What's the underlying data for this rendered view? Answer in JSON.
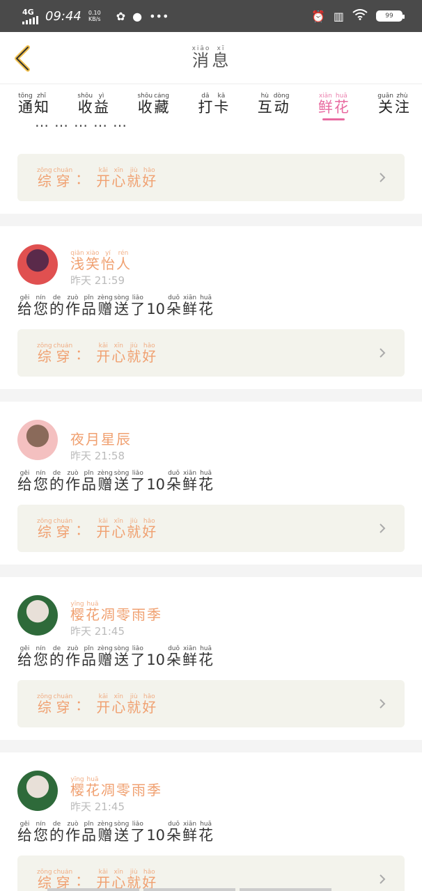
{
  "status_bar": {
    "network": "4G",
    "time": "09:44",
    "speed_top": "0.10",
    "speed_bottom": "KB/s",
    "battery": "99",
    "icons": [
      "wechat-icon",
      "qq-icon",
      "more-dots-icon",
      "alarm-icon",
      "vibrate-icon",
      "wifi-icon",
      "battery-icon"
    ]
  },
  "header": {
    "title": [
      {
        "py": "xiāo",
        "ch": "消"
      },
      {
        "py": "xī",
        "ch": "息"
      }
    ]
  },
  "tabs": [
    {
      "id": "notice",
      "chars": [
        {
          "py": "tōng",
          "ch": "通"
        },
        {
          "py": "zhī",
          "ch": "知"
        }
      ]
    },
    {
      "id": "income",
      "chars": [
        {
          "py": "shōu",
          "ch": "收"
        },
        {
          "py": "yì",
          "ch": "益"
        }
      ]
    },
    {
      "id": "favorite",
      "chars": [
        {
          "py": "shōu",
          "ch": "收"
        },
        {
          "py": "cáng",
          "ch": "藏"
        }
      ]
    },
    {
      "id": "checkin",
      "chars": [
        {
          "py": "dǎ",
          "ch": "打"
        },
        {
          "py": "kǎ",
          "ch": "卡"
        }
      ]
    },
    {
      "id": "interact",
      "chars": [
        {
          "py": "hù",
          "ch": "互"
        },
        {
          "py": "dòng",
          "ch": "动"
        }
      ]
    },
    {
      "id": "flowers",
      "active": true,
      "chars": [
        {
          "py": "xiān",
          "ch": "鲜"
        },
        {
          "py": "huā",
          "ch": "花"
        }
      ]
    },
    {
      "id": "follow",
      "chars": [
        {
          "py": "guān",
          "ch": "关"
        },
        {
          "py": "zhù",
          "ch": "注"
        }
      ]
    }
  ],
  "common": {
    "quote_label": [
      {
        "py": "zōng",
        "ch": "综"
      },
      {
        "py": "chuán",
        "ch": "穿"
      }
    ],
    "quote_sep": "：",
    "quote_value": [
      {
        "py": "kāi",
        "ch": "开"
      },
      {
        "py": "xīn",
        "ch": "心"
      },
      {
        "py": "jiù",
        "ch": "就"
      },
      {
        "py": "hǎo",
        "ch": "好"
      }
    ],
    "message": [
      {
        "py": "gěi",
        "ch": "给"
      },
      {
        "py": "nín",
        "ch": "您"
      },
      {
        "py": "de",
        "ch": "的"
      },
      {
        "py": "zuò",
        "ch": "作"
      },
      {
        "py": "pǐn",
        "ch": "品"
      },
      {
        "py": "zèng",
        "ch": "赠"
      },
      {
        "py": "sòng",
        "ch": "送"
      },
      {
        "py": "liǎo",
        "ch": "了"
      },
      {
        "py": "",
        "ch": "10"
      },
      {
        "py": "duǒ",
        "ch": "朵"
      },
      {
        "py": "xiān",
        "ch": "鲜"
      },
      {
        "py": "huā",
        "ch": "花"
      }
    ]
  },
  "items": [
    {
      "partial": true,
      "username": [],
      "time": ""
    },
    {
      "username": [
        {
          "py": "qiǎn",
          "ch": "浅"
        },
        {
          "py": "xiào",
          "ch": "笑"
        },
        {
          "py": "yí",
          "ch": "怡"
        },
        {
          "py": "rén",
          "ch": "人"
        }
      ],
      "time_prefix": "昨天",
      "time": "21:59",
      "avatar_colors": [
        "#e05050",
        "#5a2a4a"
      ]
    },
    {
      "username": [
        {
          "py": "",
          "ch": "夜"
        },
        {
          "py": "",
          "ch": "月"
        },
        {
          "py": "",
          "ch": "星"
        },
        {
          "py": "",
          "ch": "辰"
        }
      ],
      "time_prefix": "昨天",
      "time": "21:58",
      "avatar_colors": [
        "#f4c0c0",
        "#8a6a5a"
      ]
    },
    {
      "username": [
        {
          "py": "yīng",
          "ch": "樱"
        },
        {
          "py": "huā",
          "ch": "花"
        },
        {
          "py": "",
          "ch": "凋"
        },
        {
          "py": "",
          "ch": "零"
        },
        {
          "py": "",
          "ch": "雨"
        },
        {
          "py": "",
          "ch": "季"
        }
      ],
      "time_prefix": "昨天",
      "time": "21:45",
      "avatar_colors": [
        "#2e6a3a",
        "#e8e0d8"
      ]
    },
    {
      "username": [
        {
          "py": "yīng",
          "ch": "樱"
        },
        {
          "py": "huā",
          "ch": "花"
        },
        {
          "py": "",
          "ch": "凋"
        },
        {
          "py": "",
          "ch": "零"
        },
        {
          "py": "",
          "ch": "雨"
        },
        {
          "py": "",
          "ch": "季"
        }
      ],
      "time_prefix": "昨天",
      "time": "21:45",
      "avatar_colors": [
        "#2e6a3a",
        "#e8e0d8"
      ]
    }
  ],
  "partial_top_text": "……………"
}
